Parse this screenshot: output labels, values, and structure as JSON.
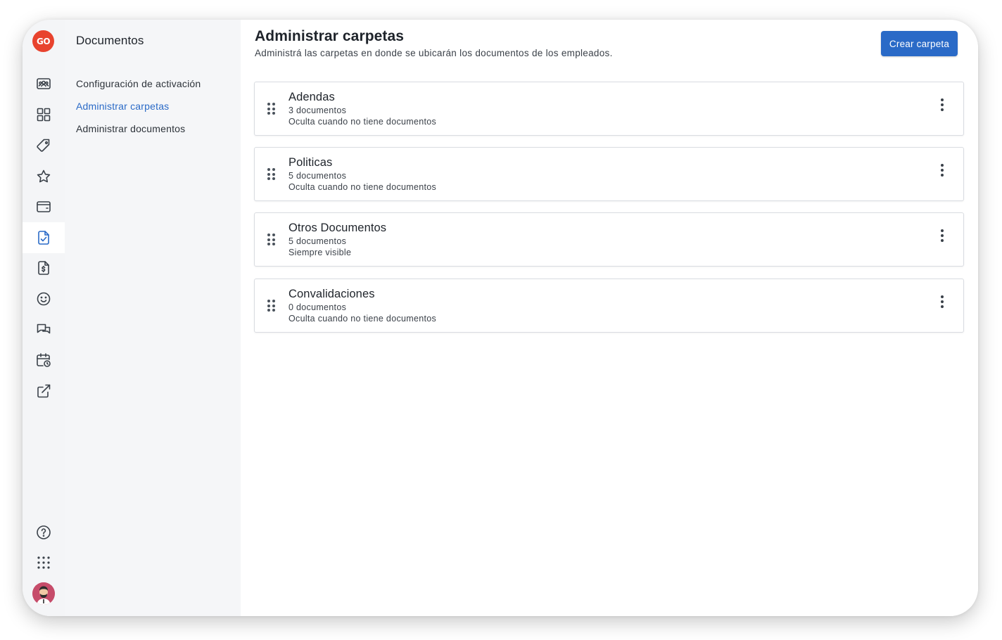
{
  "app": {
    "logo_text": "GO",
    "brand_color": "#e8432e",
    "accent_color": "#2a6ac7"
  },
  "rail": {
    "icons": [
      "people-card-icon",
      "grid-icon",
      "tag-icon",
      "star-icon",
      "wallet-icon",
      "document-check-icon",
      "document-dollar-icon",
      "smiley-icon",
      "chat-icon",
      "calendar-clock-icon",
      "external-link-icon"
    ],
    "active": "document-check-icon",
    "bottom_icons": [
      "help-icon",
      "apps-grid-icon",
      "avatar"
    ]
  },
  "subnav": {
    "title": "Documentos",
    "items": [
      {
        "label": "Configuración de activación",
        "active": false
      },
      {
        "label": "Administrar carpetas",
        "active": true
      },
      {
        "label": "Administrar documentos",
        "active": false
      }
    ]
  },
  "main": {
    "title": "Administrar carpetas",
    "subtitle": "Administrá las carpetas en donde se ubicarán los documentos de los empleados.",
    "create_button": "Crear carpeta",
    "folders": [
      {
        "name": "Adendas",
        "count": "3 documentos",
        "visibility": "Oculta cuando no tiene documentos"
      },
      {
        "name": "Politicas",
        "count": "5 documentos",
        "visibility": "Oculta cuando no tiene documentos"
      },
      {
        "name": "Otros Documentos",
        "count": "5 documentos",
        "visibility": "Siempre visible"
      },
      {
        "name": "Convalidaciones",
        "count": "0 documentos",
        "visibility": "Oculta cuando no tiene documentos"
      }
    ]
  }
}
